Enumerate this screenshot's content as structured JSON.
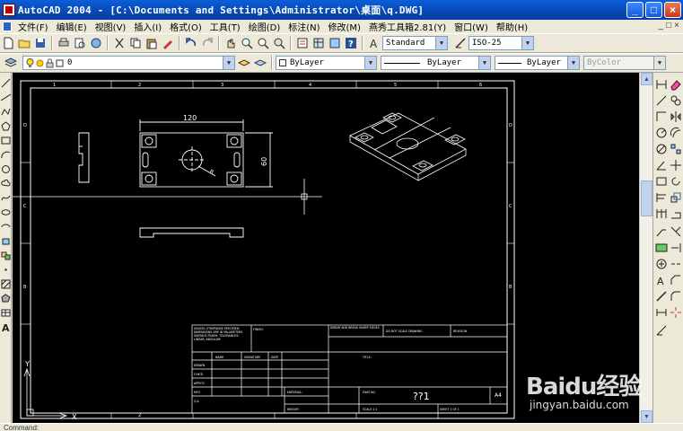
{
  "window": {
    "title": "AutoCAD 2004 - [C:\\Documents and Settings\\Administrator\\桌面\\q.DWG]",
    "buttons": [
      "_",
      "□",
      "×"
    ]
  },
  "menu": {
    "items": [
      "文件(F)",
      "编辑(E)",
      "视图(V)",
      "插入(I)",
      "格式(O)",
      "工具(T)",
      "绘图(D)",
      "标注(N)",
      "修改(M)",
      "燕秀工具箱2.81(Y)",
      "窗口(W)",
      "帮助(H)"
    ],
    "right_controls": [
      "_",
      "□",
      "×"
    ]
  },
  "toolbar_standard": {
    "text_style": "Standard",
    "dim_style": "ISO-25"
  },
  "toolbar_layers": {
    "layer_name": "0",
    "color": "ByLayer",
    "linetype": "ByLayer",
    "lineweight": "ByLayer",
    "plot_style": "ByColor"
  },
  "drawing": {
    "zone_numbers": [
      "1",
      "2",
      "3",
      "4",
      "5",
      "6"
    ],
    "zone_letters": [
      "A",
      "B",
      "C",
      "D"
    ],
    "dimension_width": "120",
    "dimension_height": "60",
    "dimension_radius": "R",
    "title_block": {
      "notes_header": "UNLESS OTHERWISE SPECIFIED: DIMENSIONS ARE IN MILLIMETERS SURFACE FINISH: TOLERANCES: LINEAR: ANGULAR:",
      "finish_label": "FINISH:",
      "deburr_label": "DEBUR AND BREAK SHARP EDGES",
      "do_not_scale": "DO NOT SCALE DRAWING",
      "revision_label": "REVISION",
      "col_name": "NAME",
      "col_signature": "SIGNATURE",
      "col_date": "DATE",
      "title_label": "TITLE:",
      "rows": [
        "DRAWN",
        "CHK'D",
        "APPV'D",
        "MFG",
        "Q.A"
      ],
      "material_label": "MATERIAL:",
      "weight_label": "WEIGHT:",
      "dwg_no_label": "DWG NO.",
      "drawing_number": "??1",
      "sheet_size": "A4",
      "scale_label": "SCALE:1:1",
      "sheet_label": "SHEET 1 OF 1"
    }
  },
  "ucs": {
    "y_label": "Y",
    "x_label": "X"
  },
  "status": {
    "text": "Command:"
  },
  "watermark": {
    "brand": "Baidu经验",
    "url": "jingyan.baidu.com"
  },
  "colors": {
    "canvas": "#000000",
    "titlebar": "#0a5fd8",
    "ui": "#ece9d8",
    "lines": "#ffffff"
  }
}
